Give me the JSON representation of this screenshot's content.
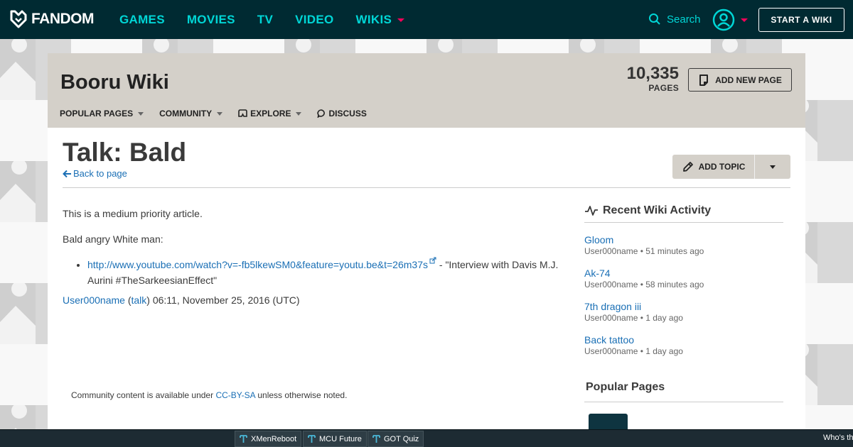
{
  "topnav": {
    "logo_text": "FANDOM",
    "links": [
      "GAMES",
      "MOVIES",
      "TV",
      "VIDEO",
      "WIKIS"
    ],
    "search_label": "Search",
    "start_wiki_label": "START A WIKI",
    "accent_color": "#00d6d6",
    "bg_color": "#002a32"
  },
  "wiki_header": {
    "title": "Booru Wiki",
    "pages_count": "10,335",
    "pages_label": "PAGES",
    "add_page_label": "ADD NEW PAGE",
    "nav": [
      "POPULAR PAGES",
      "COMMUNITY",
      "EXPLORE",
      "DISCUSS"
    ]
  },
  "page": {
    "title": "Talk: Bald",
    "back_label": "Back to page",
    "add_topic_label": "ADD TOPIC"
  },
  "article": {
    "para1": "This is a medium priority article.",
    "para2": "Bald angry White man:",
    "link_url": "http://www.youtube.com/watch?v=-fb5lkewSM0&feature=youtu.be&t=26m37s",
    "link_desc": " - \"Interview with Davis M.J. Aurini #TheSarkeesianEffect\"",
    "sig_user": "User000name",
    "sig_open": " (",
    "sig_talk": "talk",
    "sig_rest": ") 06:11, November 25, 2016 (UTC)"
  },
  "license": {
    "before": "Community content is available under ",
    "link": "CC-BY-SA",
    "after": " unless otherwise noted."
  },
  "rail": {
    "activity_title": "Recent Wiki Activity",
    "items": [
      {
        "title": "Gloom",
        "meta": "User000name • 51 minutes ago"
      },
      {
        "title": "Ak-74",
        "meta": "User000name • 58 minutes ago"
      },
      {
        "title": "7th dragon iii",
        "meta": "User000name • 1 day ago"
      },
      {
        "title": "Back tattoo",
        "meta": "User000name • 1 day ago"
      }
    ],
    "popular_title": "Popular Pages"
  },
  "taskbar": {
    "tabs": [
      "XMenReboot",
      "MCU Future",
      "GOT Quiz"
    ],
    "right_text": "Who's th"
  }
}
